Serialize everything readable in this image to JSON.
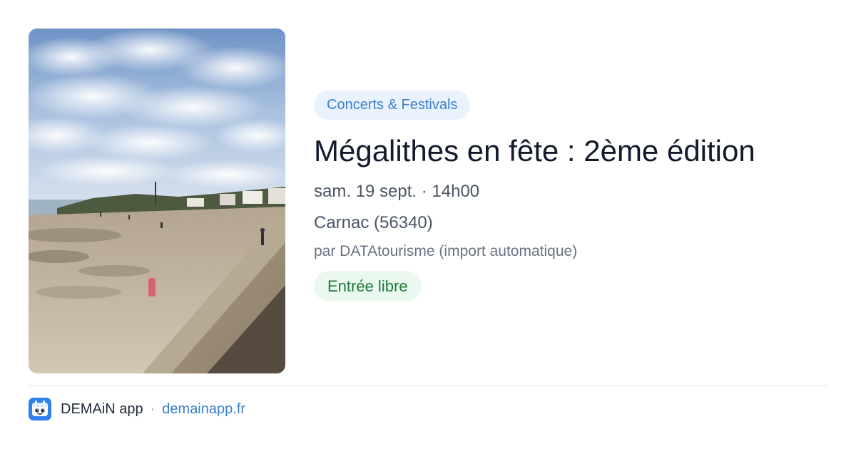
{
  "event": {
    "image": "beach-coastline-photo",
    "category": "Concerts & Festivals",
    "title": "Mégalithes en fête : 2ème édition",
    "date": "sam. 19 sept. · 14h00",
    "location": "Carnac (56340)",
    "source": "par DATAtourisme (import automatique)",
    "price": "Entrée libre"
  },
  "footer": {
    "app_name": "DEMAiN app",
    "separator": "·",
    "link": "demainapp.fr",
    "logo_icon": "demain-logo-icon"
  },
  "colors": {
    "category_bg": "#eaf3fd",
    "category_text": "#3b7fc9",
    "price_bg": "#ebf8ef",
    "price_text": "#1e7a3c",
    "title": "#121a2b",
    "link": "#3b7fc9"
  }
}
